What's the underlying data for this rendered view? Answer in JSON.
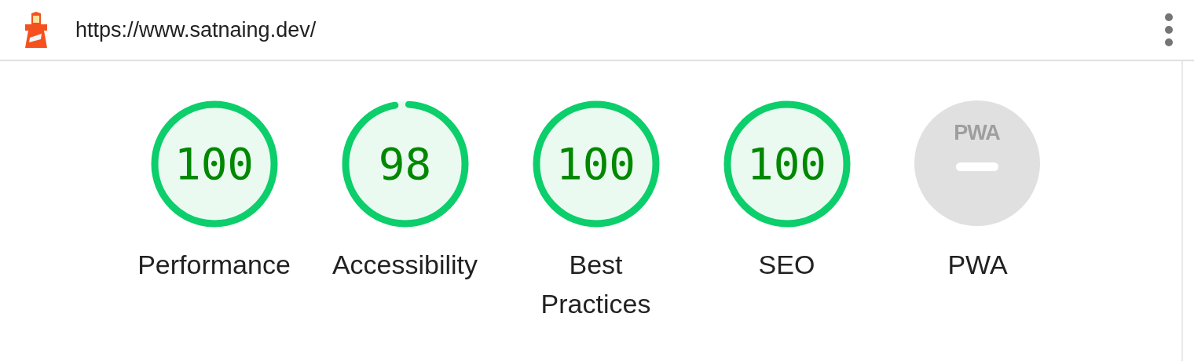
{
  "header": {
    "url": "https://www.satnaing.dev/"
  },
  "gauges": [
    {
      "kind": "score",
      "score": "100",
      "level": 1,
      "label": "Performance"
    },
    {
      "kind": "score",
      "score": "98",
      "level": 0.98,
      "label": "Accessibility"
    },
    {
      "kind": "score",
      "score": "100",
      "level": 1,
      "label": "Best Practices"
    },
    {
      "kind": "score",
      "score": "100",
      "level": 1,
      "label": "SEO"
    },
    {
      "kind": "pwa",
      "badge_text": "PWA",
      "label": "PWA"
    }
  ]
}
